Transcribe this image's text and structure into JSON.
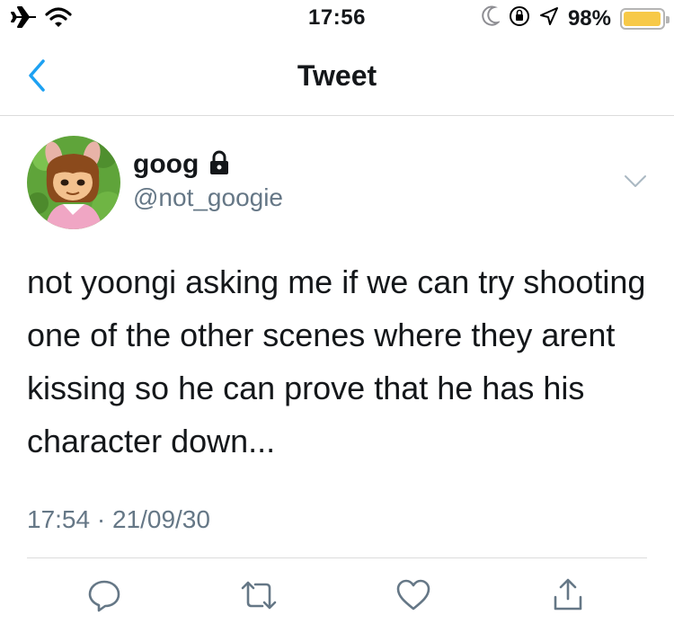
{
  "status_bar": {
    "time": "17:56",
    "battery_percent_text": "98%",
    "battery_level": 0.98,
    "battery_color": "#f7c948",
    "left_icons": [
      "airplane-icon",
      "wifi-icon"
    ],
    "right_icons": [
      "moon-icon",
      "orientation-lock-icon",
      "location-icon",
      "battery-icon"
    ]
  },
  "nav": {
    "back_icon": "chevron-left-icon",
    "title": "Tweet"
  },
  "tweet": {
    "author": {
      "display_name": "goog",
      "handle": "@not_googie",
      "protected_icon": "lock-icon"
    },
    "text": "not yoongi asking me if we can try shooting one of the other scenes where they arent kissing so he can prove that he has his character down...",
    "timestamp": "17:54 · 21/09/30",
    "menu_icon": "chevron-down-icon"
  },
  "actions": [
    "reply-icon",
    "retweet-icon",
    "like-icon",
    "share-icon"
  ],
  "colors": {
    "accent": "#1da1f2",
    "secondary_text": "#657786",
    "primary_text": "#14171a"
  }
}
